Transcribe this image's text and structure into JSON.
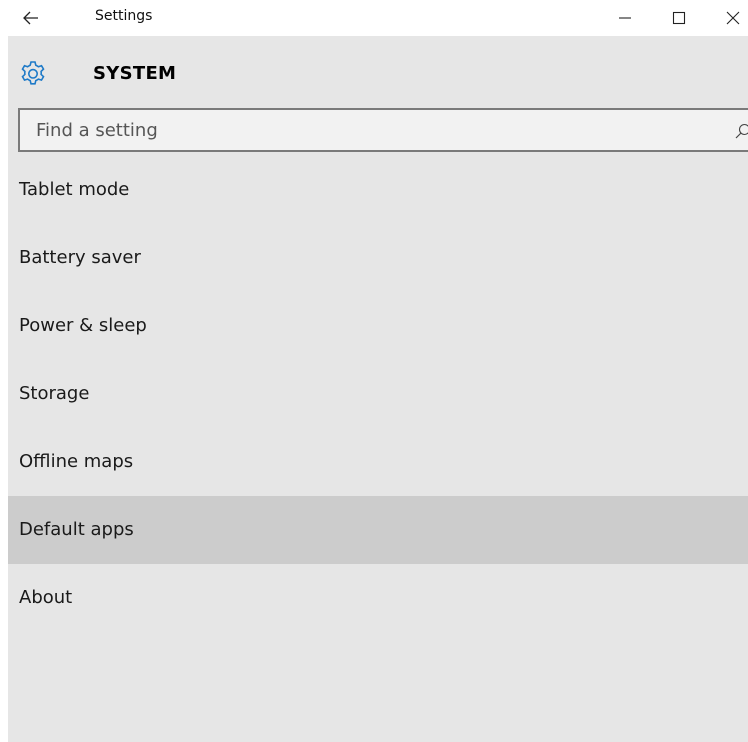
{
  "window": {
    "title": "Settings",
    "back_icon": "arrow-left-icon",
    "minimize_icon": "minimize-icon",
    "maximize_icon": "maximize-icon",
    "close_icon": "close-icon"
  },
  "header": {
    "icon": "gear-icon",
    "title": "SYSTEM",
    "icon_color": "#1e7ac8"
  },
  "search": {
    "placeholder": "Find a setting",
    "value": "",
    "icon": "search-icon"
  },
  "nav": {
    "items": [
      {
        "label": "Tablet mode",
        "selected": false
      },
      {
        "label": "Battery saver",
        "selected": false
      },
      {
        "label": "Power & sleep",
        "selected": false
      },
      {
        "label": "Storage",
        "selected": false
      },
      {
        "label": "Offline maps",
        "selected": false
      },
      {
        "label": "Default apps",
        "selected": true
      },
      {
        "label": "About",
        "selected": false
      }
    ]
  },
  "colors": {
    "background": "#e6e6e6",
    "selected_item": "#cccccc",
    "accent": "#1e7ac8"
  }
}
